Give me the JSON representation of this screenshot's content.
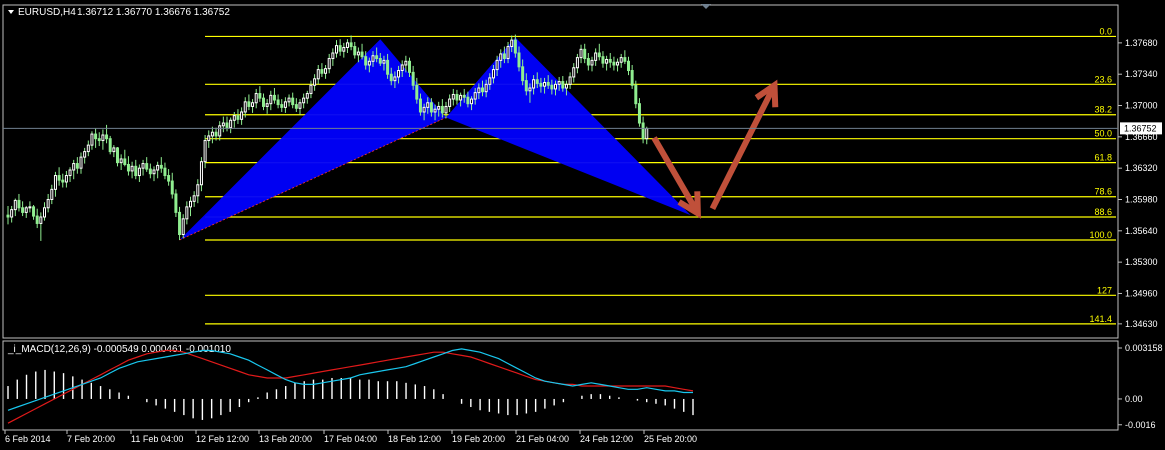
{
  "header": {
    "symbol": "EURUSD,H4",
    "ohlc": "1.36712 1.36770 1.36676 1.36752"
  },
  "macd": {
    "label": "_i_MACD(12,26,9) -0.000549 0.000461 -0.001010",
    "ticks": [
      "0.003158",
      "0.00",
      "-0.0016"
    ],
    "series_colors": {
      "main": "#19c7ee",
      "signal": "#e11a1a",
      "histogram": "#ffffff"
    }
  },
  "fib_levels": [
    "0.0",
    "23.6",
    "38.2",
    "50.0",
    "61.8",
    "78.6",
    "88.6",
    "100.0",
    "127",
    "141.4"
  ],
  "colors": {
    "fib": "#ffff00",
    "pattern": "#0000ff",
    "arrow": "#c0503a",
    "bull": "#ffffff",
    "bear": "#90ee90",
    "grid_text": "#ffffff",
    "price_box": "#ffffff"
  },
  "chart_data": {
    "type": "candlestick",
    "symbol": "EURUSD",
    "timeframe": "H4",
    "x_ticks": [
      "6 Feb 2014",
      "7 Feb 20:00",
      "11 Feb 04:00",
      "12 Feb 12:00",
      "13 Feb 20:00",
      "17 Feb 04:00",
      "18 Feb 12:00",
      "19 Feb 20:00",
      "21 Feb 04:00",
      "24 Feb 12:00",
      "25 Feb 20:00"
    ],
    "y_ticks": [
      1.3768,
      1.3734,
      1.37,
      1.3666,
      1.3632,
      1.3598,
      1.3564,
      1.353,
      1.3496,
      1.3463
    ],
    "current_price": "1.36752",
    "ylim": [
      1.3452,
      1.3795
    ],
    "fib_prices": [
      1.3775,
      1.3723,
      1.369,
      1.3664,
      1.3638,
      1.3601,
      1.3579,
      1.3554,
      1.3494,
      1.3463
    ],
    "pattern": {
      "name": "bearish harmonic (bat) with drawn projection",
      "points": [
        {
          "bar": 47,
          "price": 1.3554
        },
        {
          "bar": 102,
          "price": 1.3772
        },
        {
          "bar": 120,
          "price": 1.3687
        },
        {
          "bar": 139,
          "price": 1.3774
        },
        {
          "bar": 187,
          "price": 1.3581
        }
      ]
    },
    "arrows": [
      {
        "from_bar": 177,
        "from_price": 1.3665,
        "to_bar": 189,
        "to_price": 1.3583
      },
      {
        "from_bar": 193,
        "from_price": 1.3588,
        "to_bar": 210,
        "to_price": 1.3722
      }
    ],
    "candles": [
      [
        1.3581,
        1.3591,
        1.3571,
        1.3579
      ],
      [
        1.3579,
        1.3591,
        1.3573,
        1.3587
      ],
      [
        1.3587,
        1.3599,
        1.358,
        1.3597
      ],
      [
        1.3597,
        1.3604,
        1.3585,
        1.3589
      ],
      [
        1.3589,
        1.3596,
        1.358,
        1.3584
      ],
      [
        1.3584,
        1.3591,
        1.3578,
        1.3589
      ],
      [
        1.3589,
        1.3596,
        1.3584,
        1.359
      ],
      [
        1.359,
        1.3592,
        1.3576,
        1.358
      ],
      [
        1.358,
        1.3588,
        1.3567,
        1.3572
      ],
      [
        1.3572,
        1.3584,
        1.3553,
        1.3579
      ],
      [
        1.3579,
        1.3595,
        1.3575,
        1.3589
      ],
      [
        1.3589,
        1.3604,
        1.3584,
        1.3598
      ],
      [
        1.3598,
        1.3614,
        1.3593,
        1.3609
      ],
      [
        1.3609,
        1.3628,
        1.3601,
        1.3624
      ],
      [
        1.3624,
        1.3633,
        1.3613,
        1.3619
      ],
      [
        1.3619,
        1.3626,
        1.3611,
        1.3617
      ],
      [
        1.3617,
        1.3629,
        1.3611,
        1.3624
      ],
      [
        1.3624,
        1.3633,
        1.3617,
        1.363
      ],
      [
        1.363,
        1.3641,
        1.362,
        1.3637
      ],
      [
        1.3637,
        1.3644,
        1.3626,
        1.3632
      ],
      [
        1.3632,
        1.3649,
        1.3626,
        1.3644
      ],
      [
        1.3644,
        1.3654,
        1.3637,
        1.365
      ],
      [
        1.365,
        1.3662,
        1.3645,
        1.3657
      ],
      [
        1.3657,
        1.3672,
        1.3652,
        1.3669
      ],
      [
        1.3669,
        1.3675,
        1.3654,
        1.3664
      ],
      [
        1.3664,
        1.3671,
        1.3656,
        1.3662
      ],
      [
        1.3662,
        1.3674,
        1.3652,
        1.3668
      ],
      [
        1.3668,
        1.3679,
        1.3659,
        1.3664
      ],
      [
        1.3664,
        1.3667,
        1.3647,
        1.365
      ],
      [
        1.365,
        1.3657,
        1.3644,
        1.3654
      ],
      [
        1.3654,
        1.3655,
        1.3634,
        1.3638
      ],
      [
        1.3638,
        1.3647,
        1.363,
        1.3642
      ],
      [
        1.3642,
        1.3652,
        1.3634,
        1.3636
      ],
      [
        1.3636,
        1.3645,
        1.3624,
        1.3629
      ],
      [
        1.3629,
        1.3639,
        1.3621,
        1.3634
      ],
      [
        1.3634,
        1.3641,
        1.362,
        1.3624
      ],
      [
        1.3624,
        1.3636,
        1.3617,
        1.3632
      ],
      [
        1.3632,
        1.3641,
        1.3624,
        1.3637
      ],
      [
        1.3637,
        1.3644,
        1.3628,
        1.3631
      ],
      [
        1.3631,
        1.3637,
        1.3621,
        1.3626
      ],
      [
        1.3626,
        1.3634,
        1.3618,
        1.363
      ],
      [
        1.363,
        1.3639,
        1.3621,
        1.3635
      ],
      [
        1.3635,
        1.3644,
        1.3627,
        1.3632
      ],
      [
        1.3632,
        1.3638,
        1.362,
        1.3624
      ],
      [
        1.3624,
        1.3631,
        1.3613,
        1.3618
      ],
      [
        1.3618,
        1.3627,
        1.3599,
        1.3604
      ],
      [
        1.3604,
        1.3609,
        1.3579,
        1.3584
      ],
      [
        1.3584,
        1.359,
        1.3554,
        1.356
      ],
      [
        1.356,
        1.3582,
        1.3556,
        1.3577
      ],
      [
        1.3577,
        1.3596,
        1.3571,
        1.359
      ],
      [
        1.359,
        1.3601,
        1.358,
        1.3596
      ],
      [
        1.3596,
        1.3607,
        1.359,
        1.3602
      ],
      [
        1.3602,
        1.362,
        1.3594,
        1.3614
      ],
      [
        1.3614,
        1.3644,
        1.3607,
        1.3639
      ],
      [
        1.3639,
        1.3668,
        1.3632,
        1.3662
      ],
      [
        1.3662,
        1.3673,
        1.3654,
        1.3667
      ],
      [
        1.3667,
        1.3677,
        1.3659,
        1.3671
      ],
      [
        1.3671,
        1.3676,
        1.3662,
        1.3667
      ],
      [
        1.3667,
        1.3683,
        1.3662,
        1.3678
      ],
      [
        1.3678,
        1.3688,
        1.3671,
        1.3681
      ],
      [
        1.3681,
        1.3688,
        1.3672,
        1.3676
      ],
      [
        1.3676,
        1.3687,
        1.367,
        1.3684
      ],
      [
        1.3684,
        1.3693,
        1.3676,
        1.3689
      ],
      [
        1.3689,
        1.3696,
        1.368,
        1.3685
      ],
      [
        1.3685,
        1.3698,
        1.3679,
        1.3693
      ],
      [
        1.3693,
        1.3709,
        1.3687,
        1.3704
      ],
      [
        1.3704,
        1.3712,
        1.3695,
        1.3699
      ],
      [
        1.3699,
        1.3707,
        1.3692,
        1.3703
      ],
      [
        1.3703,
        1.3718,
        1.3697,
        1.3713
      ],
      [
        1.3713,
        1.3721,
        1.3704,
        1.3708
      ],
      [
        1.3708,
        1.3713,
        1.3695,
        1.3699
      ],
      [
        1.3699,
        1.3707,
        1.3691,
        1.3702
      ],
      [
        1.3702,
        1.3716,
        1.3695,
        1.3711
      ],
      [
        1.3711,
        1.3719,
        1.3702,
        1.3706
      ],
      [
        1.3706,
        1.3712,
        1.3697,
        1.3701
      ],
      [
        1.3701,
        1.3707,
        1.3693,
        1.3698
      ],
      [
        1.3698,
        1.3709,
        1.3692,
        1.3704
      ],
      [
        1.3704,
        1.3712,
        1.3699,
        1.3708
      ],
      [
        1.3708,
        1.3714,
        1.3697,
        1.3701
      ],
      [
        1.3701,
        1.3708,
        1.3693,
        1.3697
      ],
      [
        1.3697,
        1.3707,
        1.369,
        1.3703
      ],
      [
        1.3703,
        1.3713,
        1.3697,
        1.3708
      ],
      [
        1.3708,
        1.3716,
        1.3702,
        1.3713
      ],
      [
        1.3713,
        1.3727,
        1.3708,
        1.3722
      ],
      [
        1.3722,
        1.3734,
        1.3716,
        1.3729
      ],
      [
        1.3729,
        1.3744,
        1.3723,
        1.3739
      ],
      [
        1.3739,
        1.3746,
        1.3731,
        1.3735
      ],
      [
        1.3735,
        1.3744,
        1.3729,
        1.374
      ],
      [
        1.374,
        1.3756,
        1.3735,
        1.3751
      ],
      [
        1.3751,
        1.3762,
        1.3743,
        1.3757
      ],
      [
        1.3757,
        1.3771,
        1.3752,
        1.3765
      ],
      [
        1.3765,
        1.3772,
        1.3754,
        1.3759
      ],
      [
        1.3759,
        1.3768,
        1.3752,
        1.3763
      ],
      [
        1.3763,
        1.3772,
        1.3757,
        1.3768
      ],
      [
        1.3768,
        1.3776,
        1.376,
        1.3764
      ],
      [
        1.3764,
        1.3769,
        1.3751,
        1.3755
      ],
      [
        1.3755,
        1.3763,
        1.3747,
        1.3758
      ],
      [
        1.3758,
        1.3767,
        1.375,
        1.3753
      ],
      [
        1.3753,
        1.3759,
        1.3739,
        1.3744
      ],
      [
        1.3744,
        1.3752,
        1.3736,
        1.3748
      ],
      [
        1.3748,
        1.3759,
        1.3742,
        1.3754
      ],
      [
        1.3754,
        1.3763,
        1.3747,
        1.3751
      ],
      [
        1.3751,
        1.3757,
        1.3743,
        1.3746
      ],
      [
        1.3746,
        1.3754,
        1.3738,
        1.3749
      ],
      [
        1.3749,
        1.3756,
        1.3729,
        1.3734
      ],
      [
        1.3734,
        1.3741,
        1.3722,
        1.3727
      ],
      [
        1.3727,
        1.3737,
        1.3719,
        1.3731
      ],
      [
        1.3731,
        1.3743,
        1.3724,
        1.3738
      ],
      [
        1.3738,
        1.3749,
        1.3731,
        1.3744
      ],
      [
        1.3744,
        1.3754,
        1.3736,
        1.3748
      ],
      [
        1.3748,
        1.3752,
        1.3731,
        1.3736
      ],
      [
        1.3736,
        1.3743,
        1.3717,
        1.3722
      ],
      [
        1.3722,
        1.373,
        1.3702,
        1.3707
      ],
      [
        1.3707,
        1.3713,
        1.3689,
        1.3693
      ],
      [
        1.3693,
        1.3702,
        1.3684,
        1.3698
      ],
      [
        1.3698,
        1.3709,
        1.3691,
        1.3703
      ],
      [
        1.3703,
        1.3708,
        1.3688,
        1.3693
      ],
      [
        1.3693,
        1.3701,
        1.3684,
        1.3696
      ],
      [
        1.3696,
        1.3704,
        1.3688,
        1.3699
      ],
      [
        1.3699,
        1.3707,
        1.3687,
        1.3692
      ],
      [
        1.3692,
        1.3704,
        1.3686,
        1.3699
      ],
      [
        1.3699,
        1.3712,
        1.3693,
        1.3707
      ],
      [
        1.3707,
        1.3718,
        1.37,
        1.3712
      ],
      [
        1.3712,
        1.3717,
        1.3701,
        1.3706
      ],
      [
        1.3706,
        1.3714,
        1.3699,
        1.3711
      ],
      [
        1.3711,
        1.3718,
        1.3703,
        1.3709
      ],
      [
        1.3709,
        1.3715,
        1.3698,
        1.3702
      ],
      [
        1.3702,
        1.371,
        1.3695,
        1.3707
      ],
      [
        1.3707,
        1.3719,
        1.3701,
        1.3714
      ],
      [
        1.3714,
        1.3724,
        1.3707,
        1.3719
      ],
      [
        1.3719,
        1.3727,
        1.371,
        1.3715
      ],
      [
        1.3715,
        1.3728,
        1.3709,
        1.3723
      ],
      [
        1.3723,
        1.3735,
        1.3717,
        1.373
      ],
      [
        1.373,
        1.3744,
        1.3724,
        1.3739
      ],
      [
        1.3739,
        1.3754,
        1.3732,
        1.3749
      ],
      [
        1.3749,
        1.3761,
        1.3741,
        1.3756
      ],
      [
        1.3756,
        1.3764,
        1.3746,
        1.3751
      ],
      [
        1.3751,
        1.3769,
        1.3746,
        1.3764
      ],
      [
        1.3764,
        1.3776,
        1.3758,
        1.3771
      ],
      [
        1.3771,
        1.3777,
        1.3752,
        1.3757
      ],
      [
        1.3757,
        1.3764,
        1.3737,
        1.3742
      ],
      [
        1.3742,
        1.375,
        1.3722,
        1.3727
      ],
      [
        1.3727,
        1.3735,
        1.3711,
        1.3716
      ],
      [
        1.3716,
        1.3724,
        1.3703,
        1.3719
      ],
      [
        1.3719,
        1.3733,
        1.3712,
        1.3728
      ],
      [
        1.3728,
        1.3736,
        1.3719,
        1.3724
      ],
      [
        1.3724,
        1.373,
        1.3714,
        1.3721
      ],
      [
        1.3721,
        1.373,
        1.3713,
        1.3725
      ],
      [
        1.3725,
        1.3733,
        1.3718,
        1.3722
      ],
      [
        1.3722,
        1.3728,
        1.3712,
        1.3718
      ],
      [
        1.3718,
        1.3727,
        1.3711,
        1.3723
      ],
      [
        1.3723,
        1.3731,
        1.3716,
        1.3726
      ],
      [
        1.3726,
        1.3732,
        1.3715,
        1.3719
      ],
      [
        1.3719,
        1.3727,
        1.3711,
        1.3723
      ],
      [
        1.3723,
        1.3736,
        1.3718,
        1.3731
      ],
      [
        1.3731,
        1.3746,
        1.3725,
        1.3741
      ],
      [
        1.3741,
        1.3756,
        1.3735,
        1.3752
      ],
      [
        1.3752,
        1.3766,
        1.3746,
        1.3761
      ],
      [
        1.3761,
        1.3767,
        1.3746,
        1.3751
      ],
      [
        1.3751,
        1.3757,
        1.3738,
        1.3744
      ],
      [
        1.3744,
        1.3753,
        1.3737,
        1.3749
      ],
      [
        1.3749,
        1.3762,
        1.3743,
        1.3757
      ],
      [
        1.3757,
        1.3767,
        1.3749,
        1.3753
      ],
      [
        1.3753,
        1.3759,
        1.3741,
        1.3746
      ],
      [
        1.3746,
        1.3754,
        1.3738,
        1.375
      ],
      [
        1.375,
        1.3757,
        1.3741,
        1.3747
      ],
      [
        1.3747,
        1.3753,
        1.3738,
        1.3744
      ],
      [
        1.3744,
        1.3751,
        1.3737,
        1.3747
      ],
      [
        1.3747,
        1.3756,
        1.3741,
        1.3752
      ],
      [
        1.3752,
        1.376,
        1.3745,
        1.3748
      ],
      [
        1.3748,
        1.3753,
        1.3733,
        1.3738
      ],
      [
        1.3738,
        1.3744,
        1.3718,
        1.3722
      ],
      [
        1.3722,
        1.3727,
        1.3697,
        1.3702
      ],
      [
        1.3702,
        1.3708,
        1.3677,
        1.3681
      ],
      [
        1.3681,
        1.3688,
        1.3659,
        1.3664
      ],
      [
        1.3664,
        1.3677,
        1.3658,
        1.3675
      ]
    ],
    "macd_data": {
      "main": [
        -0.0007,
        -0.0005,
        -0.0003,
        -0.0001,
        0.0001,
        0.0003,
        0.0005,
        0.0007,
        0.0009,
        0.0011,
        0.0013,
        0.0016,
        0.0019,
        0.0021,
        0.0023,
        0.0024,
        0.0025,
        0.0026,
        0.0027,
        0.0028,
        0.0029,
        0.003,
        0.003,
        0.0029,
        0.0028,
        0.0026,
        0.0024,
        0.0021,
        0.0018,
        0.0015,
        0.0012,
        0.001,
        0.0009,
        0.0009,
        0.001,
        0.0011,
        0.0012,
        0.0013,
        0.0015,
        0.0016,
        0.0017,
        0.0018,
        0.0019,
        0.002,
        0.0022,
        0.0024,
        0.0026,
        0.0028,
        0.003,
        0.0031,
        0.003,
        0.0029,
        0.0027,
        0.0025,
        0.0022,
        0.0019,
        0.0016,
        0.0013,
        0.0011,
        0.001,
        0.0009,
        0.0008,
        0.0009,
        0.001,
        0.0009,
        0.0008,
        0.0007,
        0.0006,
        0.0006,
        0.0007,
        0.0006,
        0.0005,
        0.0005,
        0.0004,
        0.0004
      ],
      "signal": [
        -0.0015,
        -0.0012,
        -0.0009,
        -0.0006,
        -0.0003,
        0.0,
        0.0003,
        0.0006,
        0.0009,
        0.0012,
        0.0015,
        0.0018,
        0.0021,
        0.0024,
        0.0026,
        0.0028,
        0.0029,
        0.003,
        0.003,
        0.0029,
        0.0027,
        0.0025,
        0.0023,
        0.0021,
        0.0019,
        0.0017,
        0.0015,
        0.0014,
        0.0013,
        0.0013,
        0.0013,
        0.0014,
        0.0015,
        0.0016,
        0.0017,
        0.0018,
        0.0019,
        0.002,
        0.0021,
        0.0022,
        0.0023,
        0.0024,
        0.0025,
        0.0026,
        0.0027,
        0.0028,
        0.0029,
        0.0029,
        0.0028,
        0.0027,
        0.0026,
        0.0024,
        0.0022,
        0.002,
        0.0018,
        0.0016,
        0.0014,
        0.0012,
        0.0011,
        0.001,
        0.0009,
        0.0009,
        0.0008,
        0.0008,
        0.0008,
        0.0008,
        0.0008,
        0.0008,
        0.0008,
        0.0008,
        0.0008,
        0.0008,
        0.0007,
        0.0006,
        0.0005
      ],
      "histogram": [
        0.0008,
        0.0012,
        0.0015,
        0.0017,
        0.0018,
        0.0017,
        0.0016,
        0.0014,
        0.0012,
        0.001,
        0.0008,
        0.0006,
        0.0004,
        0.0002,
        0.0,
        -0.0002,
        -0.0004,
        -0.0006,
        -0.0008,
        -0.001,
        -0.0012,
        -0.0013,
        -0.0012,
        -0.001,
        -0.0008,
        -0.0005,
        -0.0002,
        0.0001,
        0.0004,
        0.0006,
        0.0008,
        0.001,
        0.0011,
        0.0012,
        0.0012,
        0.0013,
        0.0013,
        0.0013,
        0.0012,
        0.0012,
        0.0011,
        0.0011,
        0.0011,
        0.001,
        0.0009,
        0.0008,
        0.0006,
        0.0003,
        0.0,
        -0.0003,
        -0.0005,
        -0.0007,
        -0.0008,
        -0.0009,
        -0.001,
        -0.001,
        -0.0009,
        -0.0008,
        -0.0006,
        -0.0004,
        -0.0002,
        0.0,
        0.0002,
        0.0003,
        0.0003,
        0.0002,
        0.0001,
        0.0,
        -0.0001,
        -0.0002,
        -0.0003,
        -0.0004,
        -0.0006,
        -0.0008,
        -0.001
      ]
    }
  }
}
